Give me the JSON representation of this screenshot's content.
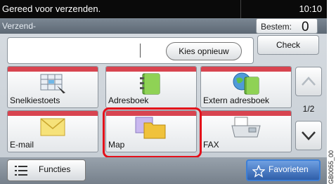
{
  "status": {
    "message": "Gereed voor verzenden.",
    "time": "10:10"
  },
  "subheader": {
    "title": "Verzend-",
    "destination_label": "Bestem:",
    "destination_count": "0"
  },
  "address": {
    "reset_label": "Kies opnieuw",
    "check_label": "Check"
  },
  "tiles": [
    {
      "label": "Snelkiestoets",
      "icon": "one-touch-key-icon"
    },
    {
      "label": "Adresboek",
      "icon": "address-book-icon"
    },
    {
      "label": "Extern adresboek",
      "icon": "external-address-book-icon"
    },
    {
      "label": "E-mail",
      "icon": "envelope-icon"
    },
    {
      "label": "Map",
      "icon": "folder-icon",
      "selected": true
    },
    {
      "label": "FAX",
      "icon": "fax-icon"
    }
  ],
  "pagination": {
    "page": "1/2"
  },
  "bottom": {
    "functions_label": "Functies",
    "favorites_label": "Favorieten"
  },
  "side_code": "GB0055_00",
  "colors": {
    "tile_accent": "#d84450",
    "highlight": "#e3101a",
    "favorites": "#2f5ea9"
  }
}
